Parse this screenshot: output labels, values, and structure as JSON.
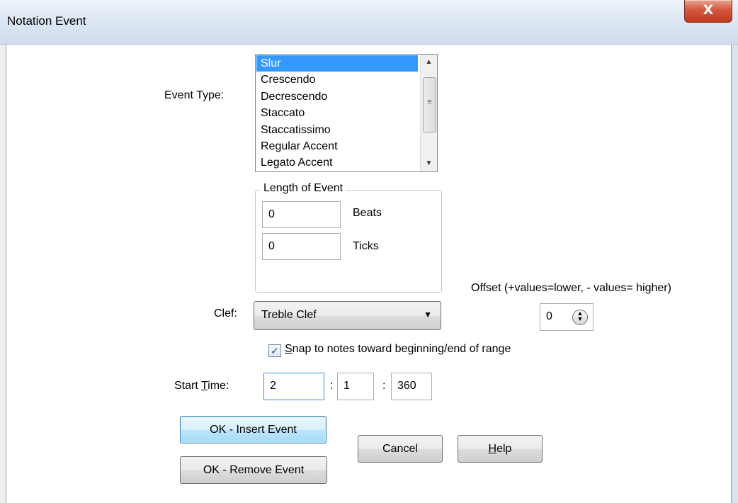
{
  "window": {
    "title": "Notation Event",
    "close_glyph": "X"
  },
  "event_type": {
    "label": "Event Type:",
    "items": [
      "Slur",
      "Crescendo",
      "Decrescendo",
      "Staccato",
      "Staccatissimo",
      "Regular Accent",
      "Legato Accent"
    ],
    "selected": "Slur"
  },
  "length_of_event": {
    "legend": "Length of Event",
    "beats_value": "0",
    "beats_label": "Beats",
    "ticks_value": "0",
    "ticks_label": "Ticks"
  },
  "offset": {
    "label": "Offset (+values=lower, - values= higher)",
    "value": "0"
  },
  "clef": {
    "label": "Clef:",
    "value": "Treble Clef"
  },
  "snap": {
    "checked": true,
    "label_underlined": "S",
    "label_rest": "nap to notes toward beginning/end of range"
  },
  "start_time": {
    "label_pre": "Start ",
    "label_underlined": "T",
    "label_post": "ime:",
    "bar": "2",
    "separator": ":",
    "beat": "1",
    "tick": "360"
  },
  "buttons": {
    "ok_insert": "OK - Insert Event",
    "ok_remove": "OK - Remove Event",
    "cancel": "Cancel",
    "help_underlined": "H",
    "help_rest": "elp"
  },
  "colors": {
    "selection": "#3399ff",
    "titlebar": "#dce7f3",
    "close_button": "#c94a33",
    "default_button": "#bee6fd"
  }
}
